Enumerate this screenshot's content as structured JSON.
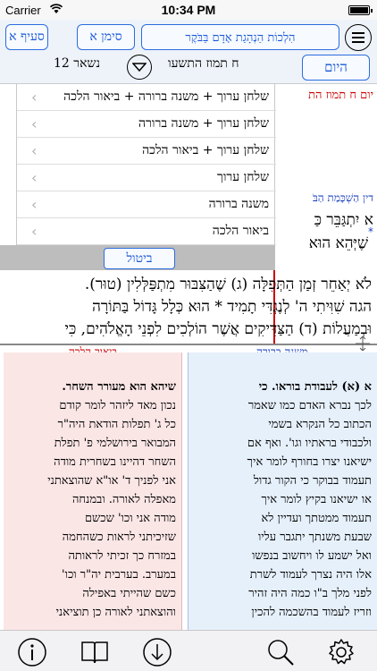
{
  "status": {
    "carrier": "Carrier",
    "time": "10:34 PM"
  },
  "toolbar": {
    "seif_label": "סעיף א",
    "siman_label": "סימן א",
    "title_label": "הִלְכוֹת הַנְהָגַת אָדָם בַּבֹּקֶר",
    "today_label": "היום",
    "date_label": "ח תמוז התשעו",
    "remaining_label": "נשאר 12"
  },
  "main": {
    "day_heading": "יום ח תמוז הת",
    "sub_heading": "דין הַשְׁכָּמַת הַבֹּ",
    "star": "*",
    "line1": "א יִתְגַּבֵּר כַּ",
    "line2": "שֶׁיְּהֵא הוּא",
    "line3": "לֹא יְאַחֵר זְמַן הַתְּפִלָּה (ג) שֶׁהַצִּבּוּר מִתְפַּלְּלִין (טוּר).",
    "line4": "הגה שִׁוִּיתִי ה' לְנֶגְדִּי תָמִיד * הוּא כְּלָל גָּדוֹל בַּתּוֹרָה",
    "line5": "וּבְמַעֲלוֹת (ד) הַצַּדִּיקִים אֲשֶׁר הוֹלְכִים לִפְנֵי הָאֱלֹהִים, כִּי"
  },
  "popup": {
    "items": [
      "שלחן ערוך + משנה ברורה + ביאור הלכה",
      "שלחן ערוך + משנה ברורה",
      "שלחן ערוך + ביאור הלכה",
      "שלחן ערוך",
      "משנה ברורה",
      "ביאור הלכה"
    ],
    "cancel_label": "ביטול"
  },
  "commentary": {
    "right_title": "משנה ברורה",
    "right_lines": [
      "א (א) לעבודת בוראו. כי",
      "לכך נברא האדם כמו שאמר",
      "הכתוב כל הנקרא בשמי",
      "ולכבודי בראתיו וגו'. ואף אם",
      "ישיאנו יצרו בחורף לומר איך",
      "תעמוד בבוקר כי הקור גדול",
      "או ישיאנו בקיץ לומר איך",
      "תעמוד ממטתך ועדיין לא",
      "שבעת משנתך יתגבר עליו",
      "ואל ישמע לו ויחשוב בנפשו",
      "אלו היה נצרך לעמוד לשרת",
      "לפני מלך ב\"ו כמה היה זהיר",
      "וזריז לעמוד בהשכמה להכין"
    ],
    "left_title": "ביאור הלכה",
    "left_lines": [
      "שיהא הוא מעורר השחר.",
      "נכון מאד ליזהר לומר קודם",
      "כל ג' תפלות הודאת היה\"ר",
      "המבואר בירושלמי פ' תפלת",
      "השחר דהיינו בשחרית מודה",
      "אני לפניך ד' או\"א שהוצאתני",
      "מאפלה לאורה. ובמנחה",
      "מודה אני וכו' שכשם",
      "שזיכיתני לראות כשהחמה",
      "במזרח כך זכיתי לראותה",
      "במערב. בערבית יה\"ר וכו'",
      "כשם שהייתי באפילה",
      "והוצאתני לאורה כן תוציאני"
    ]
  }
}
